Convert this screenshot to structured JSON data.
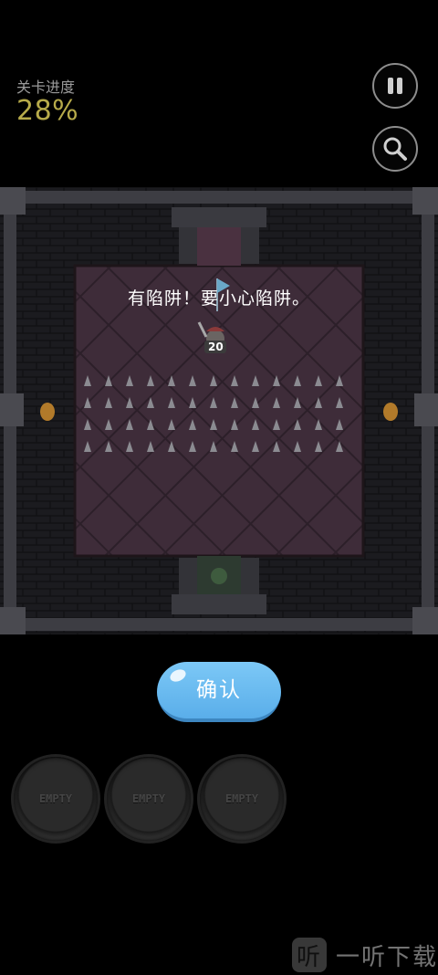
{
  "hud": {
    "progress_label": "关卡进度",
    "progress_value": "28%",
    "pause_icon": "pause-icon",
    "search_icon": "magnifier-icon"
  },
  "room": {
    "tutorial_message": "有陷阱！要小心陷阱。",
    "player_badge": "20"
  },
  "confirm_button": {
    "label": "确认",
    "color": "#66b8ef"
  },
  "item_slots": [
    {
      "label": "EMPTY"
    },
    {
      "label": "EMPTY"
    },
    {
      "label": "EMPTY"
    }
  ],
  "watermark": {
    "logo_char": "听",
    "text": "一听下载"
  },
  "colors": {
    "progress": "#b7ab4a",
    "floor": "#3f2d3a",
    "wall": "#2b2b33"
  }
}
